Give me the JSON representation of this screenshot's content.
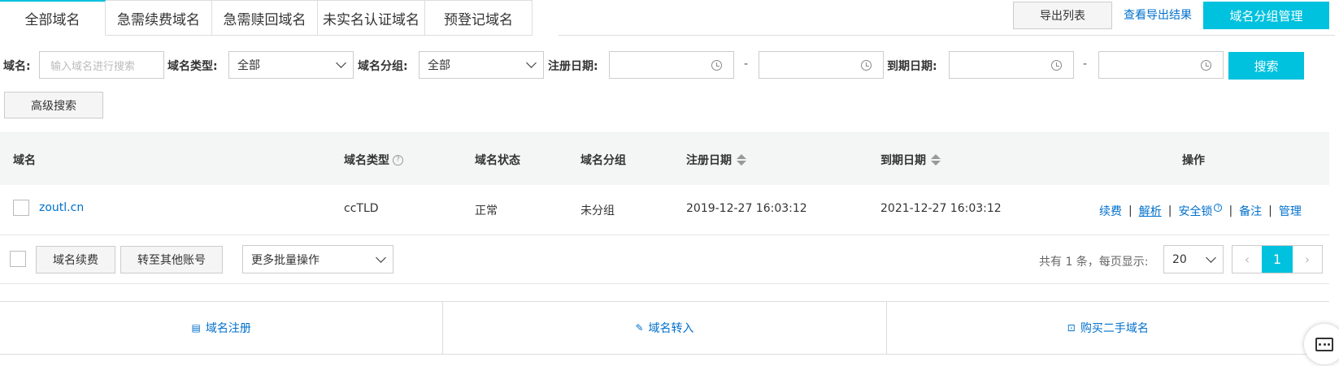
{
  "tabs": [
    {
      "label": "全部域名",
      "active": true
    },
    {
      "label": "急需续费域名",
      "active": false
    },
    {
      "label": "急需赎回域名",
      "active": false
    },
    {
      "label": "未实名认证域名",
      "active": false
    },
    {
      "label": "预登记域名",
      "active": false
    }
  ],
  "header": {
    "export_list": "导出列表",
    "view_export_results": "查看导出结果",
    "group_management": "域名分组管理"
  },
  "filters": {
    "domain_label": "域名:",
    "domain_placeholder": "输入域名进行搜索",
    "type_label": "域名类型:",
    "type_value": "全部",
    "group_label": "域名分组:",
    "group_value": "全部",
    "reg_date_label": "注册日期:",
    "exp_date_label": "到期日期:",
    "range_sep": "-",
    "search_button": "搜索",
    "advanced_search": "高级搜索"
  },
  "table": {
    "columns": [
      "域名",
      "域名类型",
      "域名状态",
      "域名分组",
      "注册日期",
      "到期日期",
      "操作"
    ],
    "rows": [
      {
        "domain": "zoutl.cn",
        "type": "ccTLD",
        "status": "正常",
        "group": "未分组",
        "reg_date": "2019-12-27 16:03:12",
        "exp_date": "2021-12-27 16:03:12",
        "actions": [
          "续费",
          "解析",
          "安全锁",
          "备注",
          "管理"
        ]
      }
    ]
  },
  "batch": {
    "renew": "域名续费",
    "transfer": "转至其他账号",
    "more_ops": "更多批量操作",
    "total_text": "共有 1 条，每页显示:",
    "page_size": "20",
    "current_page": "1",
    "prev": "‹",
    "next": "›"
  },
  "bottom_actions": [
    {
      "label": "域名注册",
      "icon": "document-icon"
    },
    {
      "label": "域名转入",
      "icon": "pencil-icon"
    },
    {
      "label": "购买二手域名",
      "icon": "cart-icon"
    }
  ],
  "colors": {
    "accent": "#00c1de",
    "link": "#0070cc"
  }
}
